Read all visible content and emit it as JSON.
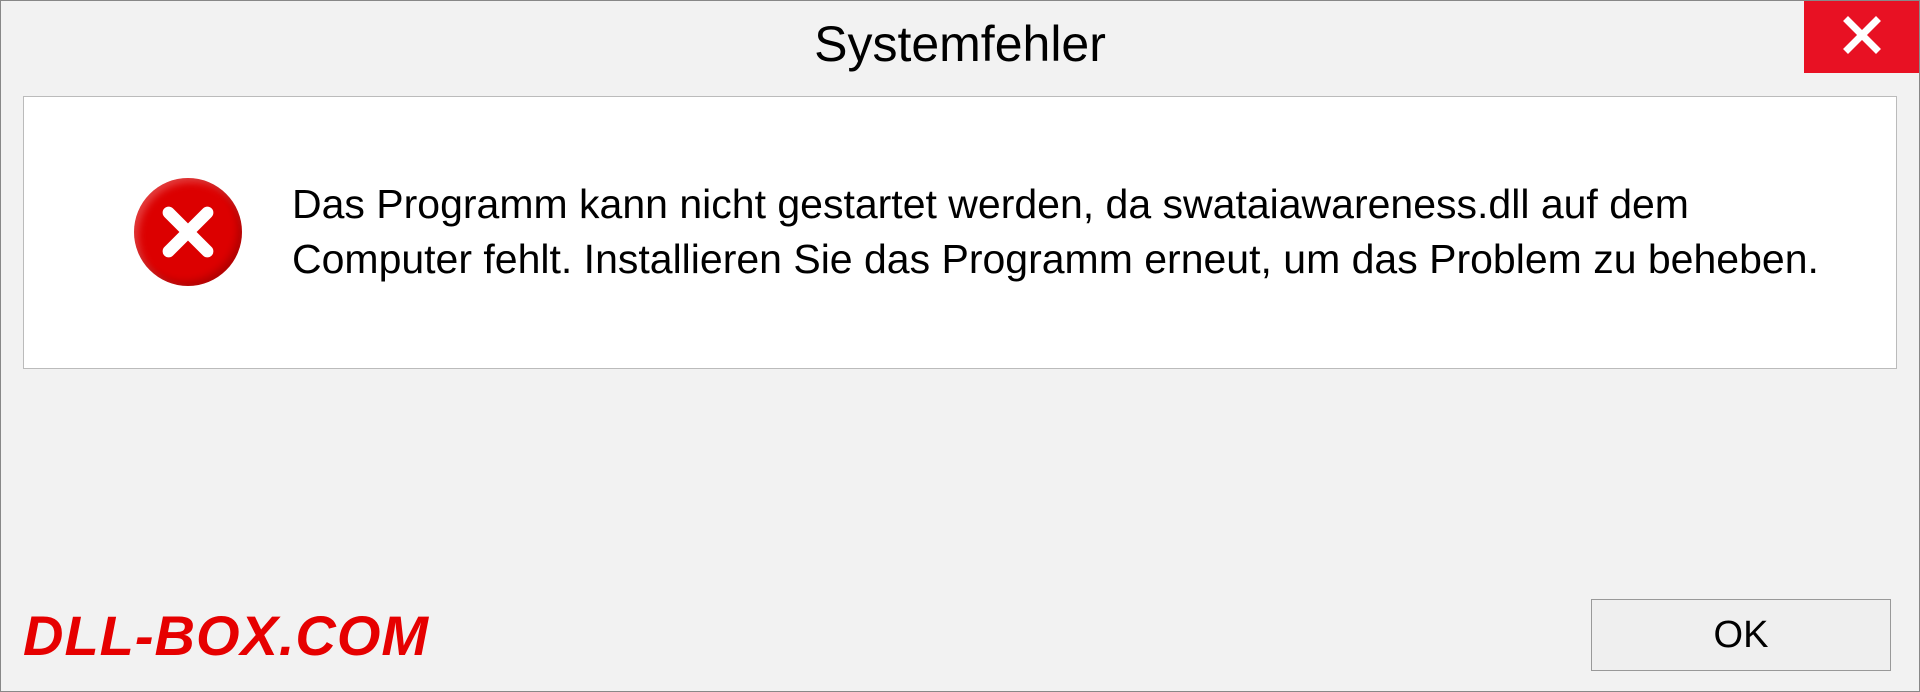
{
  "title": "Systemfehler",
  "message": "Das Programm kann nicht gestartet werden, da swataiawareness.dll auf dem Computer fehlt. Installieren Sie das Programm erneut, um das Problem zu beheben.",
  "watermark": "DLL-BOX.COM",
  "ok_label": "OK"
}
